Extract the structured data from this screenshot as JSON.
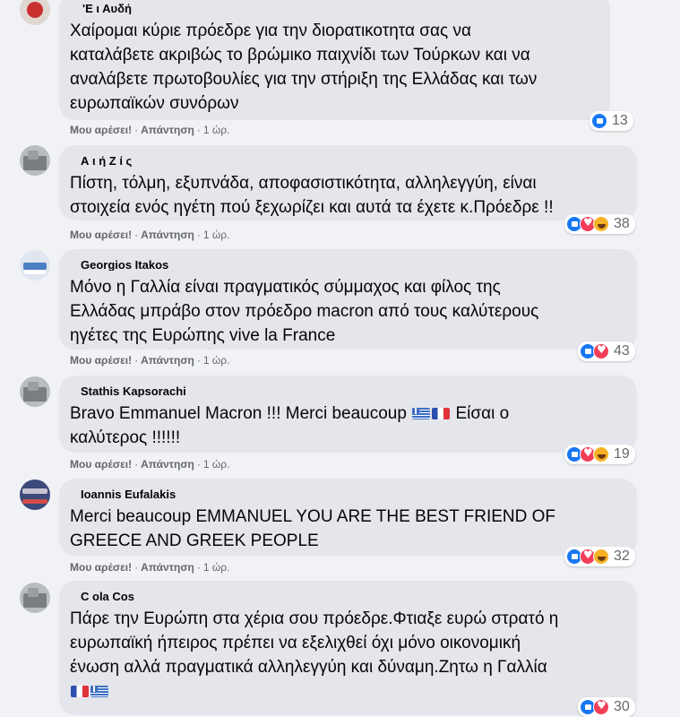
{
  "comments": [
    {
      "name": "'Ε ι Αυδή",
      "text": "Χαίρομαι κύριε πρόεδρε για την διορατικοτητα σας να\nκαταλάβετε ακριβώς το βρώμικο παιχνίδι των Τούρκων και να\nαναλάβετε πρωτοβουλίες για την στήριξη της Ελλάδας και των\nευρωπαϊκών συνόρων",
      "reactions": [
        "like"
      ],
      "count": "13",
      "like_label": "Μου αρέσει!",
      "reply_label": "Απάντηση",
      "time": "1 ώρ."
    },
    {
      "name": "Α ι ή Ζ ί ς",
      "text": "Πίστη, τόλμη, εξυπνάδα, αποφασιστικότητα, αλληλεγγύη, είναι\nστοιχεία ενός ηγέτη πού ξεχωρίζει και αυτά τα έχετε κ.Πρόεδρε !!",
      "reactions": [
        "like",
        "love",
        "haha"
      ],
      "count": "38",
      "like_label": "Μου αρέσει!",
      "reply_label": "Απάντηση",
      "time": "1 ώρ."
    },
    {
      "name": "Georgios Itakos",
      "text": "Μόνο η Γαλλία είναι πραγματικός σύμμαχος και φίλος της\nΕλλάδας μπράβο στον πρόεδρο macron από τους καλύτερους\nηγέτες της Ευρώπης vive la France",
      "reactions": [
        "like",
        "love"
      ],
      "count": "43",
      "like_label": "Μου αρέσει!",
      "reply_label": "Απάντηση",
      "time": "1 ώρ."
    },
    {
      "name": "Stathis Kapsorachi",
      "text_before": "Bravo Emmanuel Macron !!! Merci beaucoup ",
      "text_after": " Είσαι ο\nκαλύτερος !!!!!!",
      "reactions": [
        "like",
        "love",
        "haha"
      ],
      "count": "19",
      "like_label": "Μου αρέσει!",
      "reply_label": "Απάντηση",
      "time": "1 ώρ."
    },
    {
      "name": "Ioannis Eufalakis",
      "text": "Merci beaucoup EMMANUEL YOU ARE THE BEST FRIEND OF\nGREECE AND GREEK PEOPLE",
      "reactions": [
        "like",
        "love",
        "haha"
      ],
      "count": "32",
      "like_label": "Μου αρέσει!",
      "reply_label": "Απάντηση",
      "time": "1 ώρ."
    },
    {
      "name": "C ola Cos",
      "text": "Πάρε την Ευρώπη στα χέρια σου πρόεδρε.Φτιαξε ευρώ στρατό η\nευρωπαϊκή ήπειρος πρέπει να εξελιχθεί όχι μόνο οικονομική\nένωση αλλά πραγματικά αλληλεγγύη και δύναμη.Ζητω η Γαλλία",
      "reactions": [
        "like",
        "love"
      ],
      "count": "30",
      "like_label": "Μου αρέσει!",
      "reply_label": "Απάντηση",
      "time": "1 ώρ."
    }
  ]
}
